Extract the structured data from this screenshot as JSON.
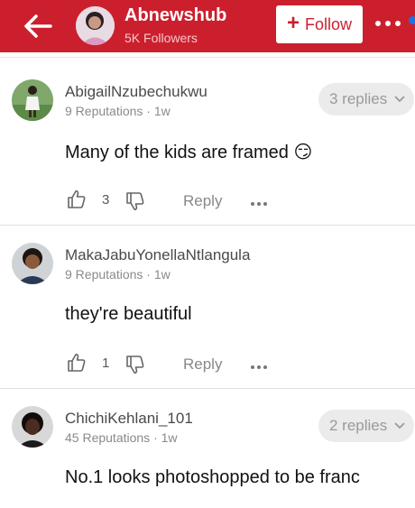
{
  "header": {
    "channel_name": "Abnewshub",
    "followers": "5K Followers",
    "follow_label": "Follow",
    "icons": [
      "back-arrow-icon",
      "plus-icon",
      "more-options-icon"
    ],
    "accent_color": "#cc1f2d"
  },
  "comments": [
    {
      "username": "AbigailNzubechukwu",
      "meta": "9 Reputations · 1w",
      "text": "Many of the kids are framed 😏",
      "replies": "3 replies",
      "likes": "3",
      "reply_label": "Reply"
    },
    {
      "username": "MakaJabuYonellaNtlangula",
      "meta": "9 Reputations · 1w",
      "text": "they're beautiful",
      "likes": "1",
      "reply_label": "Reply"
    },
    {
      "username": "ChichiKehlani_101",
      "meta": "45 Reputations · 1w",
      "text": "No.1 looks photoshopped to be franc",
      "replies": "2 replies"
    }
  ]
}
